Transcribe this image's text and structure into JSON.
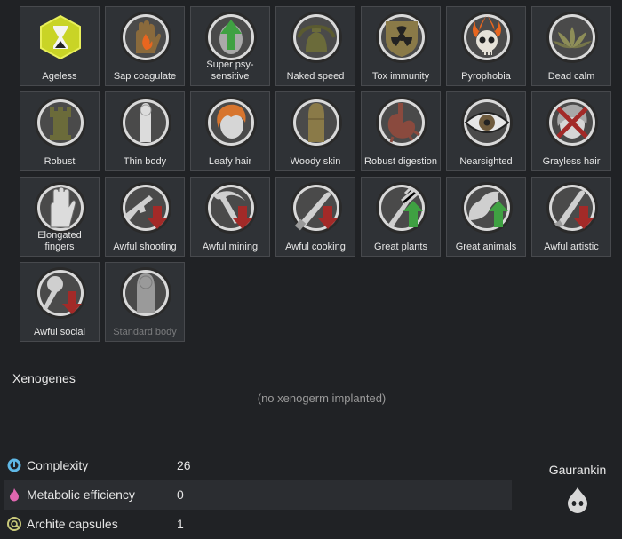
{
  "genes": [
    {
      "label": "Ageless",
      "icon": "hourglass-icon"
    },
    {
      "label": "Sap coagulate",
      "icon": "hand-flame-icon"
    },
    {
      "label": "Super psy-sensitive",
      "icon": "head-up-arrow-icon"
    },
    {
      "label": "Naked speed",
      "icon": "bell-torso-icon"
    },
    {
      "label": "Tox immunity",
      "icon": "radiation-shield-icon"
    },
    {
      "label": "Pyrophobia",
      "icon": "flaming-skull-icon"
    },
    {
      "label": "Dead calm",
      "icon": "lotus-icon"
    },
    {
      "label": "Robust",
      "icon": "tower-icon"
    },
    {
      "label": "Thin body",
      "icon": "thin-body-icon"
    },
    {
      "label": "Leafy hair",
      "icon": "leafy-hair-icon"
    },
    {
      "label": "Woody skin",
      "icon": "woody-body-icon"
    },
    {
      "label": "Robust digestion",
      "icon": "stomach-icon"
    },
    {
      "label": "Nearsighted",
      "icon": "eye-icon"
    },
    {
      "label": "Grayless hair",
      "icon": "crossed-hair-icon"
    },
    {
      "label": "Elongated fingers",
      "icon": "hand-icon"
    },
    {
      "label": "Awful shooting",
      "icon": "rifle-down-arrow-icon"
    },
    {
      "label": "Awful mining",
      "icon": "pickaxe-down-arrow-icon"
    },
    {
      "label": "Awful cooking",
      "icon": "knife-down-arrow-icon"
    },
    {
      "label": "Great plants",
      "icon": "plant-up-arrow-icon"
    },
    {
      "label": "Great animals",
      "icon": "animal-up-arrow-icon"
    },
    {
      "label": "Awful artistic",
      "icon": "brush-down-arrow-icon"
    },
    {
      "label": "Awful social",
      "icon": "microphone-down-arrow-icon"
    },
    {
      "label": "Standard body",
      "icon": "standard-body-icon"
    }
  ],
  "xenogenes": {
    "title": "Xenogenes",
    "empty_text": "(no xenogerm implanted)"
  },
  "stats": [
    {
      "name": "Complexity",
      "value": "26",
      "icon": "complexity-icon",
      "color": "#5fb8e6"
    },
    {
      "name": "Metabolic efficiency",
      "value": "0",
      "icon": "metabolic-icon",
      "color": "#e067b0"
    },
    {
      "name": "Archite capsules",
      "value": "1",
      "icon": "archite-icon",
      "color": "#c9c97a"
    }
  ],
  "xenotype": {
    "name": "Gaurankin",
    "icon": "xenotype-icon"
  },
  "colors": {
    "arrow_up": "#3fa142",
    "arrow_down": "#a32a28",
    "ageless_badge": "#c9d426"
  }
}
